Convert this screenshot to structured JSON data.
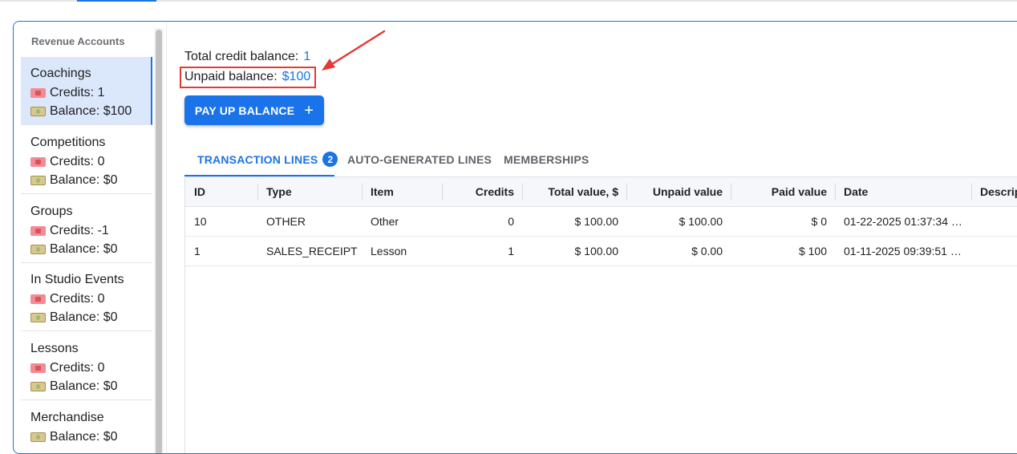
{
  "sidebar": {
    "title": "Revenue Accounts",
    "accounts": [
      {
        "name": "Coachings",
        "credits": "Credits: 1",
        "balance": "Balance: $100",
        "selected": true
      },
      {
        "name": "Competitions",
        "credits": "Credits: 0",
        "balance": "Balance: $0"
      },
      {
        "name": "Groups",
        "credits": "Credits: -1",
        "balance": "Balance: $0"
      },
      {
        "name": "In Studio Events",
        "credits": "Credits: 0",
        "balance": "Balance: $0"
      },
      {
        "name": "Lessons",
        "credits": "Credits: 0",
        "balance": "Balance: $0"
      },
      {
        "name": "Merchandise",
        "balance": "Balance: $0"
      }
    ]
  },
  "summary": {
    "total_label": "Total credit balance:",
    "total_value": "1",
    "unpaid_label": "Unpaid balance:",
    "unpaid_value": "$100"
  },
  "pay_button": {
    "label": "PAY UP BALANCE",
    "icon": "+"
  },
  "tabs": [
    {
      "label": "TRANSACTION LINES",
      "badge": "2",
      "active": true
    },
    {
      "label": "AUTO-GENERATED LINES"
    },
    {
      "label": "MEMBERSHIPS"
    }
  ],
  "table": {
    "columns": [
      "ID",
      "Type",
      "Item",
      "Credits",
      "Total value, $",
      "Unpaid value",
      "Paid value",
      "Date",
      "Descrip"
    ],
    "rows": [
      [
        "10",
        "OTHER",
        "Other",
        "0",
        "$ 100.00",
        "$ 100.00",
        "$ 0",
        "01-22-2025 01:37:34 …",
        ""
      ],
      [
        "1",
        "SALES_RECEIPT",
        "Lesson",
        "1",
        "$ 100.00",
        "$ 0.00",
        "$ 100",
        "01-11-2025 09:39:51 …",
        ""
      ]
    ]
  },
  "colors": {
    "accent": "#1a73e8",
    "highlight": "#e53935"
  },
  "icons": {
    "credits": "ticket-icon",
    "balance": "money-icon"
  }
}
